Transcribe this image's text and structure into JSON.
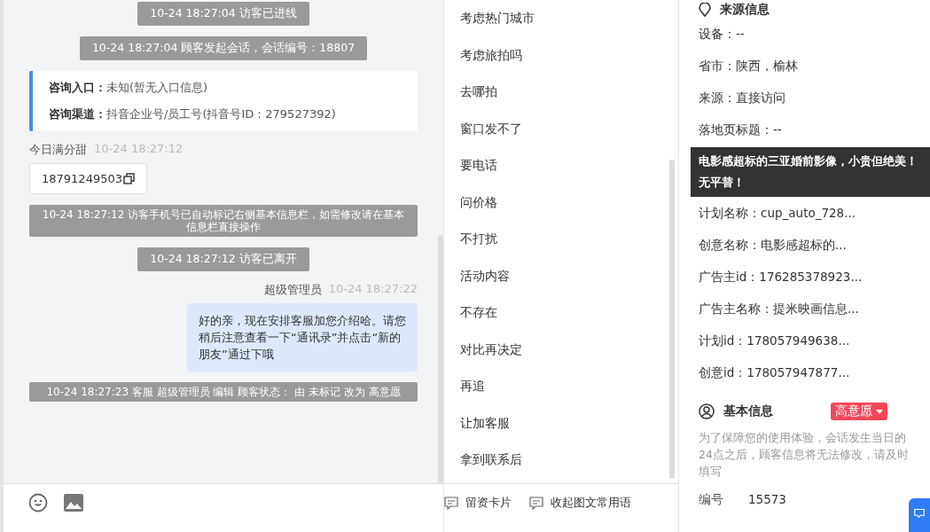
{
  "chat": {
    "messages": [
      {
        "kind": "system",
        "text": "10-24 18:27:04 访客已进线"
      },
      {
        "kind": "system",
        "text": "10-24 18:27:04 顾客发起会话，会话编号：18807"
      },
      {
        "kind": "info",
        "rows": [
          {
            "label": "咨询入口：",
            "value": "未知(暂无入口信息)"
          },
          {
            "label": "咨询渠道：",
            "value": "抖音企业号/员工号(抖音号ID：279527392)"
          }
        ]
      },
      {
        "kind": "visitor",
        "sender": "今日满分甜",
        "time": "10-24 18:27:12",
        "text": "18791249503"
      },
      {
        "kind": "notice",
        "text": "10-24 18:27:12 访客手机号已自动标记右侧基本信息栏，如需修改请在基本信息栏直接操作"
      },
      {
        "kind": "system",
        "text": "10-24 18:27:12 访客已离开"
      },
      {
        "kind": "agent",
        "sender": "超级管理员",
        "time": "10-24 18:27:22",
        "text": "好的亲，现在安排客服加您介绍哈。请您稍后注意查看一下“通讯录”并点击“新的朋友”通过下哦"
      },
      {
        "kind": "notice",
        "text": "10-24 18:27:23 客服 超级管理员 编辑 顾客状态： 由 未标记 改为 高意愿"
      }
    ]
  },
  "quick_replies": {
    "items": [
      "考虑热门城市",
      "考虑旅拍吗",
      "去哪拍",
      "窗口发不了",
      "要电话",
      "问价格",
      "不打扰",
      "活动内容",
      "不存在",
      "对比再决定",
      "再追",
      "让加客服",
      "拿到联系后"
    ],
    "toolbar": [
      "留资卡片",
      "收起图文常用语"
    ]
  },
  "source_info": {
    "title": "来源信息",
    "fields": [
      "设备：--",
      "省市：陕西，榆林",
      "来源：直接访问",
      "落地页标题：--",
      "计划名称：cup_auto_728...",
      "创意名称：电影感超标的...",
      "广告主id：176285378923...",
      "广告主名称：提米映画信息...",
      "计划id：178057949638...",
      "创意id：178057947877..."
    ],
    "tooltip": "电影感超标的三亚婚前影像，小贵但绝美！无平替！"
  },
  "basic_info": {
    "title": "基本信息",
    "intent_tag": "高意愿",
    "notice": "为了保障您的使用体验，会话发生当日的24点之后，顾客信息将无法修改，请及时填写",
    "fields": [
      {
        "label": "编号",
        "value": "15573"
      }
    ]
  }
}
